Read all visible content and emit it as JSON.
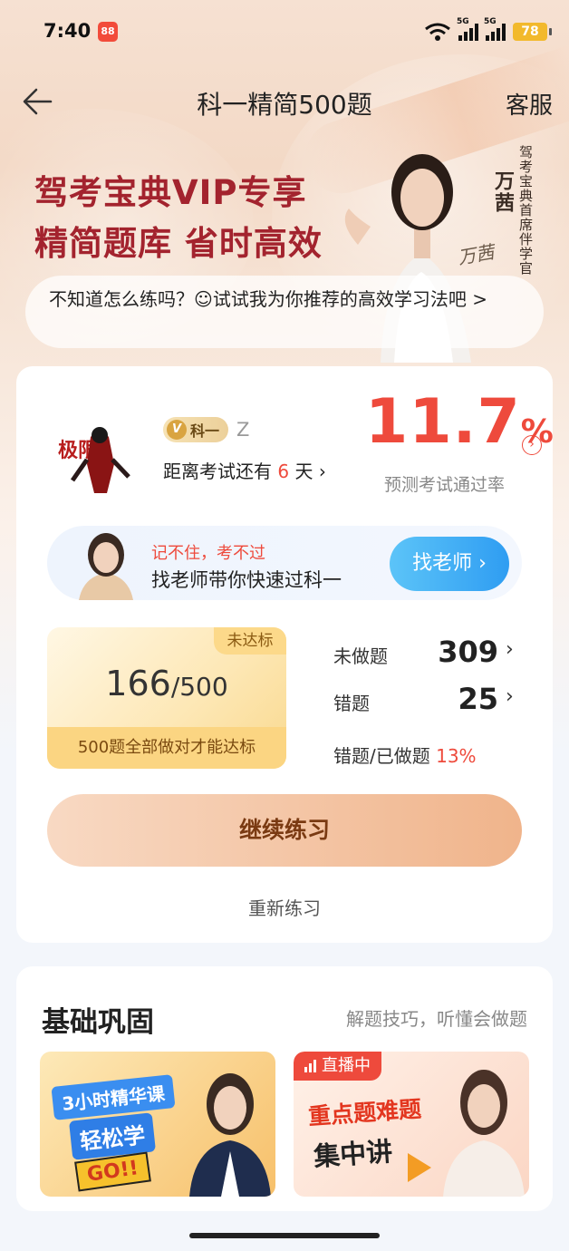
{
  "status_bar": {
    "time": "7:40",
    "app_badge": "88",
    "signal_tag": "5G",
    "battery": "78"
  },
  "nav": {
    "title": "科一精简500题",
    "service_label": "客服"
  },
  "banner": {
    "line1": "驾考宝典VIP专享",
    "line2": "精简题库 省时高效",
    "person_name": "万茜",
    "person_title": "驾考宝典首席伴学官",
    "signature": "万茜"
  },
  "tip": {
    "text": "不知道怎么练吗？☺试试我为你推荐的高效学习法吧 >"
  },
  "profile": {
    "badge_label": "科一",
    "username": "Z",
    "exam_prefix": "距离考试还有",
    "exam_days": "6",
    "exam_suffix": "天",
    "chevron": "›"
  },
  "pass_rate": {
    "value": "11.7",
    "unit": "%",
    "label": "预测考试通过率"
  },
  "teacher_promo": {
    "line1": "记不住，考不过",
    "line2": "找老师带你快速过科一",
    "button": "找老师 ›"
  },
  "progress": {
    "done": "166",
    "total": "/500",
    "status_tag": "未达标",
    "note": "500题全部做对才能达标"
  },
  "stats": {
    "undone_label": "未做题",
    "undone_value": "309",
    "wrong_label": "错题",
    "wrong_value": "25",
    "ratio_label": "错题/已做题",
    "ratio_value": "13%",
    "chevron": "›"
  },
  "actions": {
    "continue": "继续练习",
    "restart": "重新练习"
  },
  "section": {
    "title": "基础巩固",
    "subtitle": "解题技巧，听懂会做题",
    "course1": {
      "line1": "3小时精华课",
      "line2": "轻松学",
      "go": "GO!!"
    },
    "course2": {
      "live": "直播中",
      "line1": "重点题难题",
      "line2": "集中讲"
    }
  },
  "colors": {
    "accent_red": "#ee4a3c",
    "button_blue": "#2f9df2",
    "banner_red": "#a3232e"
  }
}
